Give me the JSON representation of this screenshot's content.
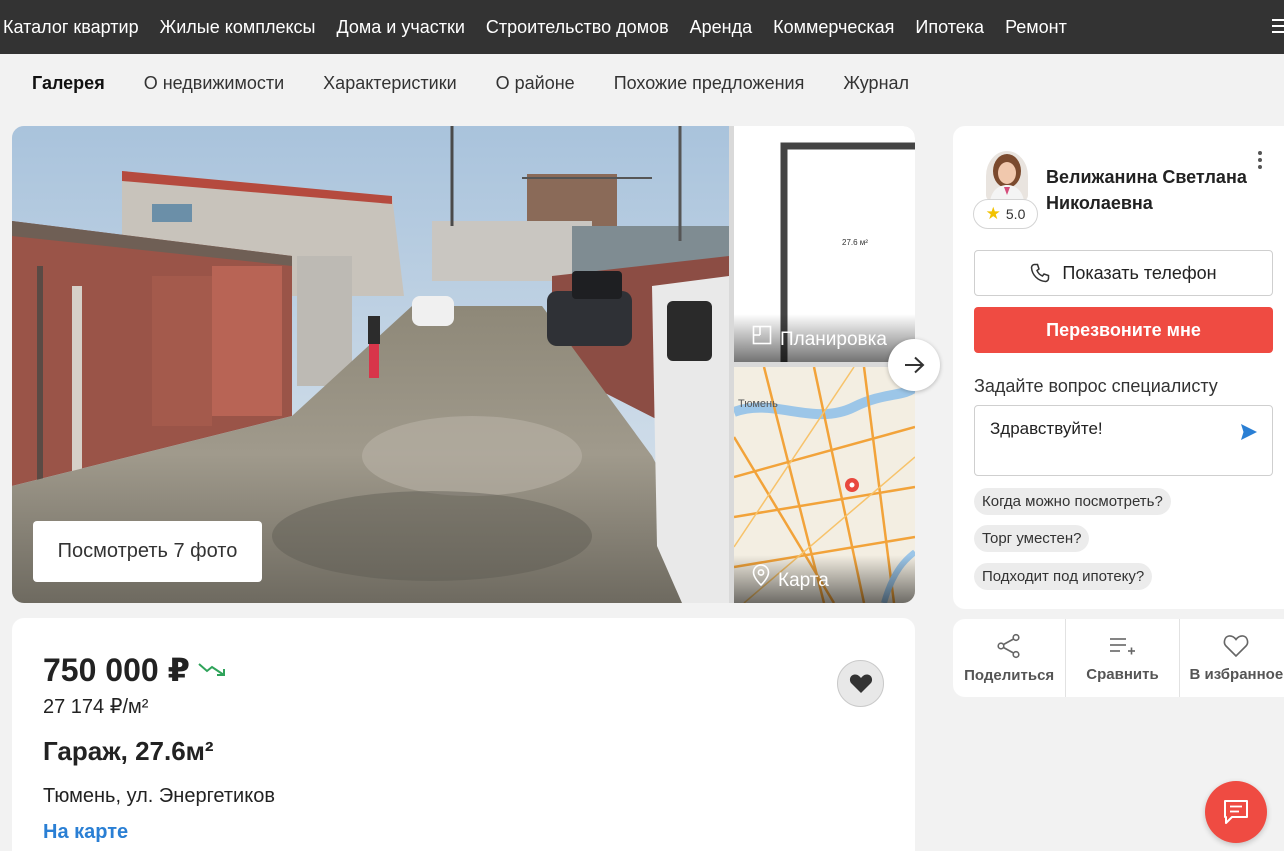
{
  "topnav": {
    "items": [
      "Каталог квартир",
      "Жилые комплексы",
      "Дома и участки",
      "Строительство домов",
      "Аренда",
      "Коммерческая",
      "Ипотека",
      "Ремонт"
    ]
  },
  "tabs": {
    "items": [
      "Галерея",
      "О недвижимости",
      "Характеристики",
      "О районе",
      "Похожие предложения",
      "Журнал"
    ],
    "active": "Галерея"
  },
  "gallery": {
    "photos_button": "Посмотреть 7 фото",
    "plan_label": "Планировка",
    "plan_area": "27.6 м²",
    "map_label": "Карта",
    "map_city": "Тюмень"
  },
  "listing": {
    "price": "750 000 ₽",
    "price_per_m": "27 174 ₽/м²",
    "title": "Гараж, 27.6м²",
    "address": "Тюмень, ул. Энергетиков",
    "map_link": "На карте"
  },
  "agent": {
    "name": "Велижанина Светлана Николаевна",
    "rating": "5.0",
    "show_phone": "Показать телефон",
    "callback": "Перезвоните мне",
    "ask_label": "Задайте вопрос специалисту",
    "message": "Здравствуйте!",
    "quick_questions": [
      "Когда можно посмотреть?",
      "Торг уместен?",
      "Подходит под ипотеку?"
    ]
  },
  "actions": {
    "share": "Поделиться",
    "compare": "Сравнить",
    "favorite": "В избранное"
  },
  "colors": {
    "nav_bg": "#333333",
    "accent_red": "#ef4b42",
    "link_blue": "#2a7fd4",
    "trend_green": "#2fa35a"
  }
}
